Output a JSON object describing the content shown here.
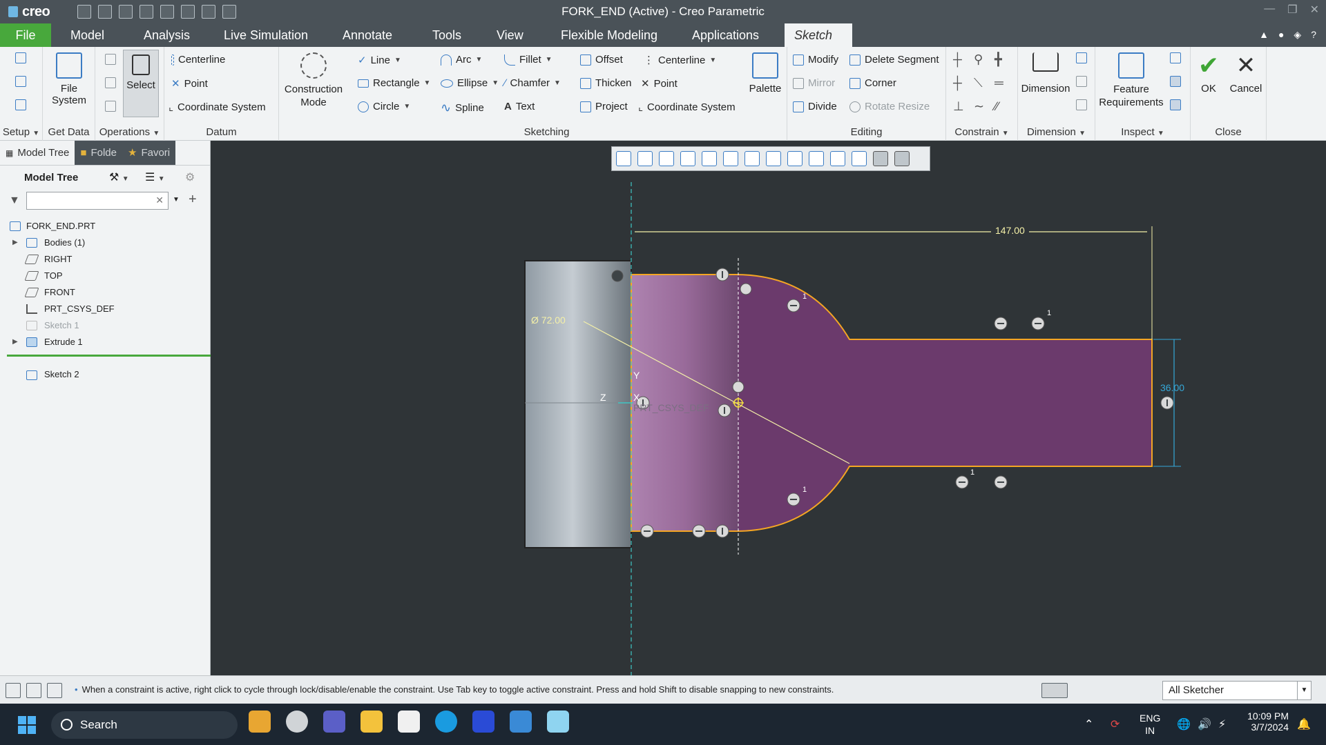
{
  "window": {
    "logo": "creo",
    "title": "FORK_END (Active) - Creo Parametric"
  },
  "tabs": [
    "File",
    "Model",
    "Analysis",
    "Live Simulation",
    "Annotate",
    "Tools",
    "View",
    "Flexible Modeling",
    "Applications",
    "Sketch"
  ],
  "ribbon": {
    "setup_label": "Setup",
    "getdata": {
      "file_system": "File System",
      "label": "Get Data"
    },
    "operations": {
      "select": "Select",
      "label": "Operations"
    },
    "datum": {
      "centerline": "Centerline",
      "point": "Point",
      "coordinate_system": "Coordinate System",
      "label": "Datum"
    },
    "construction_mode": "Construction Mode",
    "sketching": {
      "line": "Line",
      "rectangle": "Rectangle",
      "circle": "Circle",
      "arc": "Arc",
      "ellipse": "Ellipse",
      "spline": "Spline",
      "fillet": "Fillet",
      "chamfer": "Chamfer",
      "text": "Text",
      "offset": "Offset",
      "thicken": "Thicken",
      "project": "Project",
      "centerline": "Centerline",
      "point": "Point",
      "coordinate_system": "Coordinate System",
      "palette": "Palette",
      "label": "Sketching"
    },
    "editing": {
      "modify": "Modify",
      "mirror": "Mirror",
      "divide": "Divide",
      "delete_segment": "Delete Segment",
      "corner": "Corner",
      "rotate_resize": "Rotate Resize",
      "label": "Editing"
    },
    "constrain_label": "Constrain",
    "dimension": {
      "dimension": "Dimension",
      "label": "Dimension"
    },
    "inspect": {
      "feature_requirements": "Feature Requirements",
      "label": "Inspect"
    },
    "close": {
      "ok": "OK",
      "cancel": "Cancel",
      "label": "Close"
    }
  },
  "left_panel": {
    "tabs": [
      "Model Tree",
      "Folde",
      "Favori"
    ],
    "header": "Model Tree",
    "tree": [
      {
        "label": "FORK_END.PRT",
        "expandable": false,
        "greyed": false
      },
      {
        "label": "Bodies (1)",
        "expandable": true,
        "greyed": false
      },
      {
        "label": "RIGHT",
        "expandable": false,
        "greyed": false
      },
      {
        "label": "TOP",
        "expandable": false,
        "greyed": false
      },
      {
        "label": "FRONT",
        "expandable": false,
        "greyed": false
      },
      {
        "label": "PRT_CSYS_DEF",
        "expandable": false,
        "greyed": false
      },
      {
        "label": "Sketch 1",
        "expandable": false,
        "greyed": true
      },
      {
        "label": "Extrude 1",
        "expandable": true,
        "greyed": false
      }
    ],
    "insert_node": "Sketch 2"
  },
  "sketch": {
    "dim_length": "147.00",
    "dim_diameter": "Ø 72.00",
    "dim_height": "36.00",
    "csys_label": "PRT_CSYS_DEF",
    "axis_y": "Y",
    "axis_x": "X",
    "axis_z": "Z",
    "constraint_index": "1",
    "colors": {
      "profile": "#f5a623",
      "fill": "#6b3a6c",
      "dim": "#f4f0a8",
      "dim_blue": "#35a8d8"
    }
  },
  "statusbar": {
    "message": "When a constraint is active, right click to cycle through lock/disable/enable the constraint. Use Tab key to toggle active constraint. Press and hold Shift to disable snapping to new constraints.",
    "filter": "All Sketcher"
  },
  "taskbar": {
    "search": "Search",
    "lang_1": "ENG",
    "lang_2": "IN",
    "time": "10:09 PM",
    "date": "3/7/2024"
  }
}
